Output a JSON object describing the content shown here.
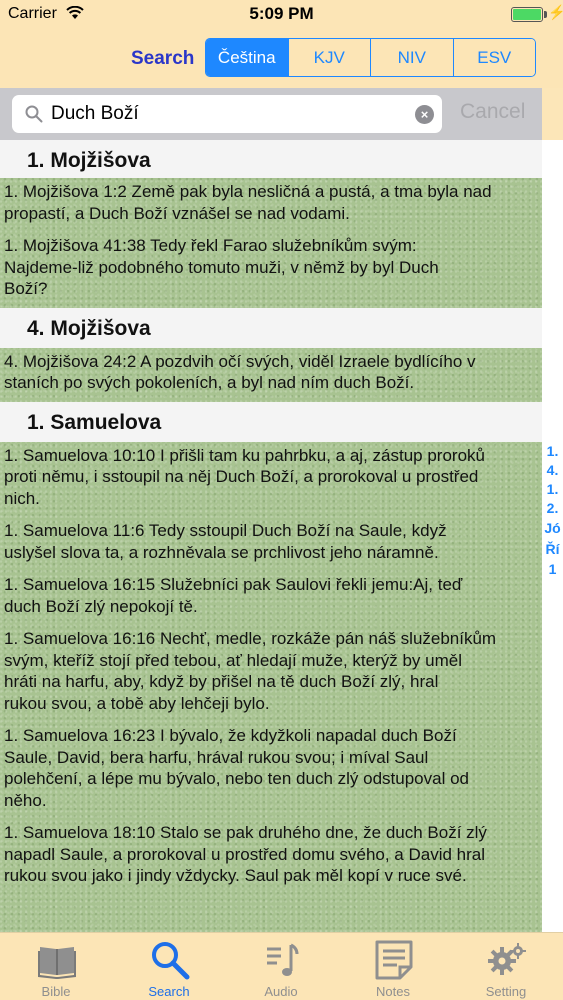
{
  "status": {
    "carrier": "Carrier",
    "time": "5:09 PM"
  },
  "header": {
    "title": "Search",
    "translations": [
      "Čeština",
      "KJV",
      "NIV",
      "ESV"
    ],
    "active_translation": "Čeština"
  },
  "search": {
    "query": "Duch Boží",
    "cancel": "Cancel"
  },
  "sections": [
    {
      "title": "1. Mojžišova",
      "verses": [
        [
          "1. Mojžišova 1:2 Země pak byla nesličná a pustá, a tma byla nad",
          "propastí, a Duch Boží vznášel se nad vodami."
        ],
        [
          "1. Mojžišova 41:38 Tedy řekl Farao služebníkům svým:",
          "Najdeme-liž podobného tomuto muži, v němž by byl Duch",
          "Boží?"
        ]
      ]
    },
    {
      "title": "4. Mojžišova",
      "verses": [
        [
          "4. Mojžišova 24:2 A pozdvih očí svých, viděl Izraele bydlícího v",
          "staních po svých pokoleních, a byl nad ním duch Boží."
        ]
      ]
    },
    {
      "title": "1. Samuelova",
      "verses": [
        [
          "1. Samuelova 10:10 I přišli tam ku pahrbku, a aj, zástup proroků",
          "proti němu, i sstoupil na něj Duch Boží, a prorokoval u prostřed",
          "nich."
        ],
        [
          "1. Samuelova 11:6 Tedy sstoupil Duch Boží na Saule, když",
          "uslyšel slova ta, a rozhněvala se prchlivost jeho náramně."
        ],
        [
          "1. Samuelova 16:15 Služebníci pak Saulovi řekli jemu:Aj, teď",
          "duch Boží zlý nepokojí tě."
        ],
        [
          "1. Samuelova 16:16 Nechť, medle, rozkáže pán náš služebníkům",
          "svým, kteříž stojí před tebou, ať hledají muže, kterýž by uměl",
          "hráti na harfu, aby, když by přišel na tě duch Boží zlý, hral",
          "rukou svou, a tobě aby lehčeji bylo."
        ],
        [
          "1. Samuelova 16:23 I bývalo, že kdyžkoli napadal duch Boží",
          "Saule, David, bera harfu, hrával rukou svou; i míval Saul",
          "polehčení, a lépe mu bývalo, nebo ten duch zlý odstupoval od",
          "něho."
        ],
        [
          "1. Samuelova 18:10 Stalo se pak druhého dne, že duch Boží zlý",
          "napadl Saule, a prorokoval u prostřed domu svého, a David hral",
          "rukou svou jako i jindy vždycky. Saul pak měl kopí v ruce své."
        ]
      ]
    }
  ],
  "index": [
    "1.",
    "4.",
    "1.",
    "2.",
    "Jó",
    "Ří",
    "1"
  ],
  "tabs": [
    {
      "label": "Bible",
      "icon": "book-icon"
    },
    {
      "label": "Search",
      "icon": "magnifier-icon"
    },
    {
      "label": "Audio",
      "icon": "music-note-icon"
    },
    {
      "label": "Notes",
      "icon": "notes-icon"
    },
    {
      "label": "Setting",
      "icon": "gear-icon"
    }
  ],
  "active_tab": "Search",
  "colors": {
    "accent": "#1e88ff",
    "title": "#2a36c9",
    "bar": "#fce5b6"
  }
}
